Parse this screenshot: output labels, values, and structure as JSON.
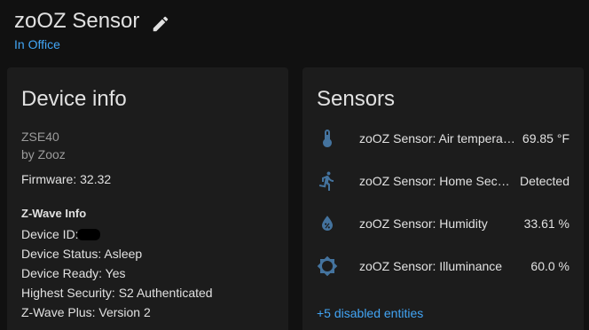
{
  "header": {
    "device_name": "zoOZ Sensor",
    "area": "In Office"
  },
  "device_info": {
    "title": "Device info",
    "model": "ZSE40",
    "manufacturer": "by Zooz",
    "firmware_label": "Firmware: ",
    "firmware_value": "32.32",
    "zwave": {
      "heading": "Z-Wave Info",
      "device_id_label": "Device ID:",
      "device_status": "Device Status: Asleep",
      "device_ready": "Device Ready: Yes",
      "highest_security": "Highest Security: S2 Authenticated",
      "zwave_plus": "Z-Wave Plus: Version 2"
    }
  },
  "sensors": {
    "title": "Sensors",
    "items": [
      {
        "icon": "thermometer-icon",
        "name": "zoOZ Sensor: Air temperature",
        "state": "69.85 °F"
      },
      {
        "icon": "motion-icon",
        "name": "zoOZ Sensor: Home Security Motion",
        "state": "Detected"
      },
      {
        "icon": "humidity-icon",
        "name": "zoOZ Sensor: Humidity",
        "state": "33.61 %"
      },
      {
        "icon": "brightness-icon",
        "name": "zoOZ Sensor: Illuminance",
        "state": "60.0 %"
      }
    ],
    "disabled_entities": "+5 disabled entities"
  },
  "colors": {
    "background": "#111111",
    "card": "#1c1c1c",
    "accent": "#42a5f5",
    "icon": "#44739e"
  }
}
